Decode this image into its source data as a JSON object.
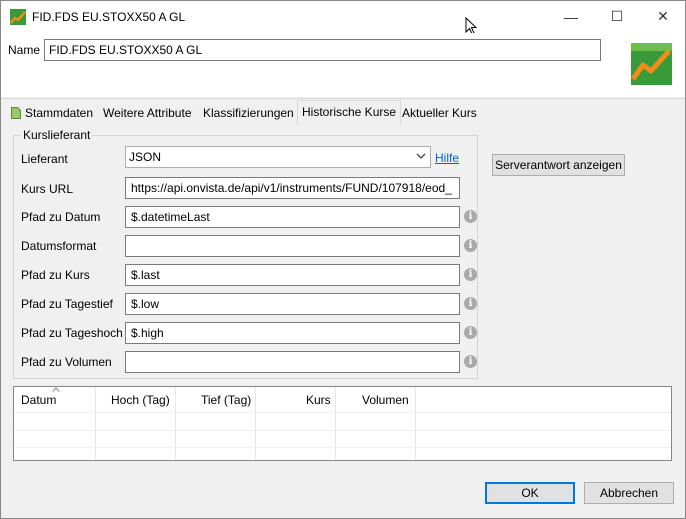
{
  "window": {
    "title": "FID.FDS EU.STOXX50 A GL",
    "minimize": "—",
    "maximize": "☐",
    "close": "✕"
  },
  "name": {
    "label": "Name",
    "value": "FID.FDS EU.STOXX50 A GL"
  },
  "tabs": [
    {
      "label": "Stammdaten",
      "icon": "page-icon"
    },
    {
      "label": "Weitere Attribute"
    },
    {
      "label": "Klassifizierungen"
    },
    {
      "label": "Historische Kurse",
      "active": true
    },
    {
      "label": "Aktueller Kurs"
    }
  ],
  "provider_group": {
    "title": "Kurslieferant",
    "provider_label": "Lieferant",
    "provider_value": "JSON",
    "help_link": "Hilfe",
    "fields": [
      {
        "label": "Kurs URL",
        "value": "https://api.onvista.de/api/v1/instruments/FUND/107918/eod_",
        "info": false
      },
      {
        "label": "Pfad zu Datum",
        "value": "$.datetimeLast",
        "info": true
      },
      {
        "label": "Datumsformat",
        "value": "",
        "info": true
      },
      {
        "label": "Pfad zu Kurs",
        "value": "$.last",
        "info": true
      },
      {
        "label": "Pfad zu Tagestief",
        "value": "$.low",
        "info": true
      },
      {
        "label": "Pfad zu Tageshoch",
        "value": "$.high",
        "info": true
      },
      {
        "label": "Pfad zu Volumen",
        "value": "",
        "info": true
      }
    ]
  },
  "server_button": "Serverantwort anzeigen",
  "table": {
    "columns": [
      "Datum",
      "Hoch (Tag)",
      "Tief (Tag)",
      "Kurs",
      "Volumen"
    ]
  },
  "footer": {
    "ok": "OK",
    "cancel": "Abbrechen"
  },
  "colors": {
    "accent": "#0078d7",
    "link": "#0066cc",
    "logo_green": "#3a9a3a",
    "logo_orange": "#f28c1a"
  }
}
